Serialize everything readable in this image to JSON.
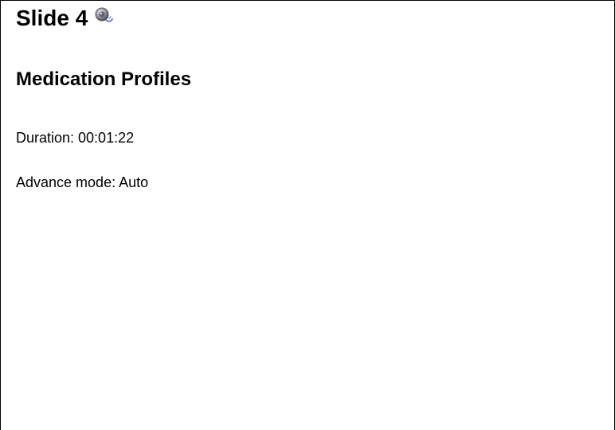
{
  "slide": {
    "title": "Slide 4",
    "audio_icon": "speaker-icon",
    "heading": "Medication Profiles",
    "duration_text": "Duration: 00:01:22",
    "advance_mode_text": "Advance mode: Auto"
  },
  "colors": {
    "text": "#000000",
    "border": "#000000",
    "background": "#ffffff"
  }
}
